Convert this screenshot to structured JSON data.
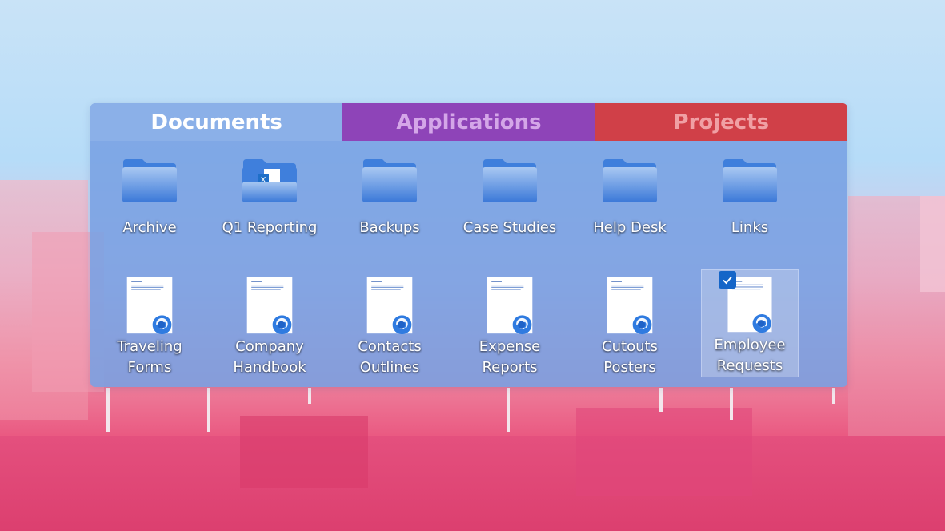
{
  "tabs": [
    {
      "label": "Documents",
      "active": true
    },
    {
      "label": "Applications",
      "active": false
    },
    {
      "label": "Projects",
      "active": false
    }
  ],
  "folders": [
    {
      "label": "Archive",
      "icon": "folder-icon"
    },
    {
      "label": "Q1 Reporting",
      "icon": "excel-folder-icon"
    },
    {
      "label": "Backups",
      "icon": "folder-icon"
    },
    {
      "label": "Case Studies",
      "icon": "folder-icon"
    },
    {
      "label": "Help Desk",
      "icon": "folder-icon"
    },
    {
      "label": "Links",
      "icon": "folder-icon"
    }
  ],
  "files": [
    {
      "line1": "Traveling",
      "line2": "Forms",
      "icon": "edge-document-icon"
    },
    {
      "line1": "Company",
      "line2": "Handbook",
      "icon": "edge-document-icon"
    },
    {
      "line1": "Contacts",
      "line2": "Outlines",
      "icon": "edge-document-icon"
    },
    {
      "line1": "Expense",
      "line2": "Reports",
      "icon": "edge-document-icon"
    },
    {
      "line1": "Cutouts",
      "line2": "Posters",
      "icon": "edge-document-icon"
    },
    {
      "line1": "Employee",
      "line2": "Requests",
      "icon": "edge-document-icon",
      "selected": true
    }
  ],
  "colors": {
    "documents_tab": "#8cb0e8",
    "applications_tab": "#8e44b8",
    "projects_tab": "#d04048",
    "folder_blue": "#3a78d8",
    "selection_check": "#1565c8"
  }
}
